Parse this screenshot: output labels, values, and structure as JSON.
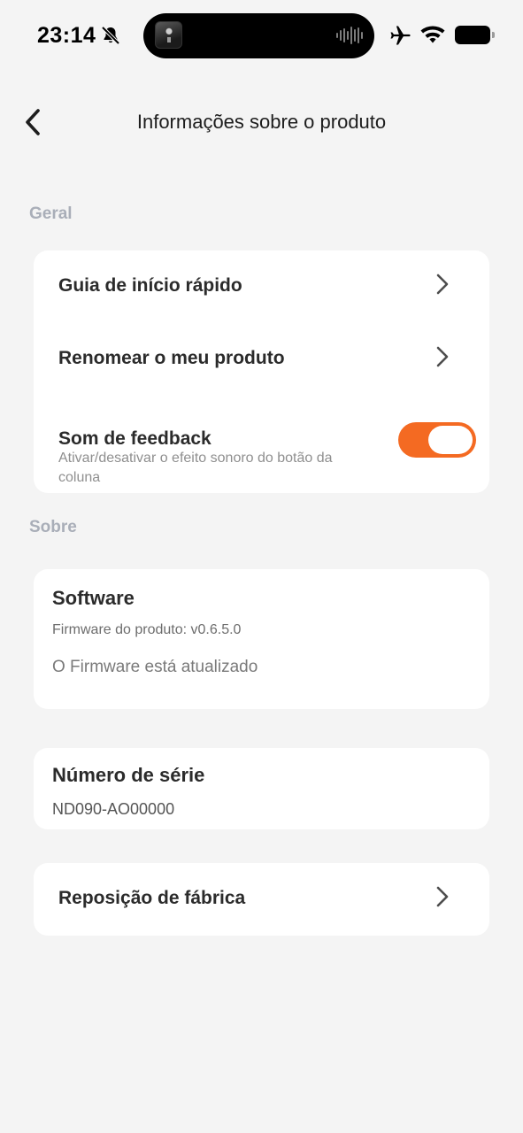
{
  "status": {
    "time": "23:14"
  },
  "header": {
    "title": "Informações sobre o produto"
  },
  "sections": {
    "general": "Geral",
    "about": "Sobre"
  },
  "general": {
    "quick_start": "Guia de início rápido",
    "rename": "Renomear o meu produto",
    "feedback_title": "Som de feedback",
    "feedback_desc": "Ativar/desativar o efeito sonoro do botão da coluna",
    "feedback_enabled": true
  },
  "software": {
    "title": "Software",
    "firmware_version": "Firmware do produto: v0.6.5.0",
    "firmware_status": "O Firmware está atualizado"
  },
  "serial": {
    "title": "Número de série",
    "value": "ND09⁠0-AO00⁠⁠000"
  },
  "factory_reset": {
    "label": "Reposição de fábrica"
  },
  "colors": {
    "accent": "#f46a22",
    "background": "#f4f4f4",
    "section_label": "#a9aeb8"
  },
  "icons": [
    "bell-off-icon",
    "airplane-icon",
    "wifi-icon",
    "battery-icon",
    "back-icon",
    "chevron-right-icon"
  ]
}
